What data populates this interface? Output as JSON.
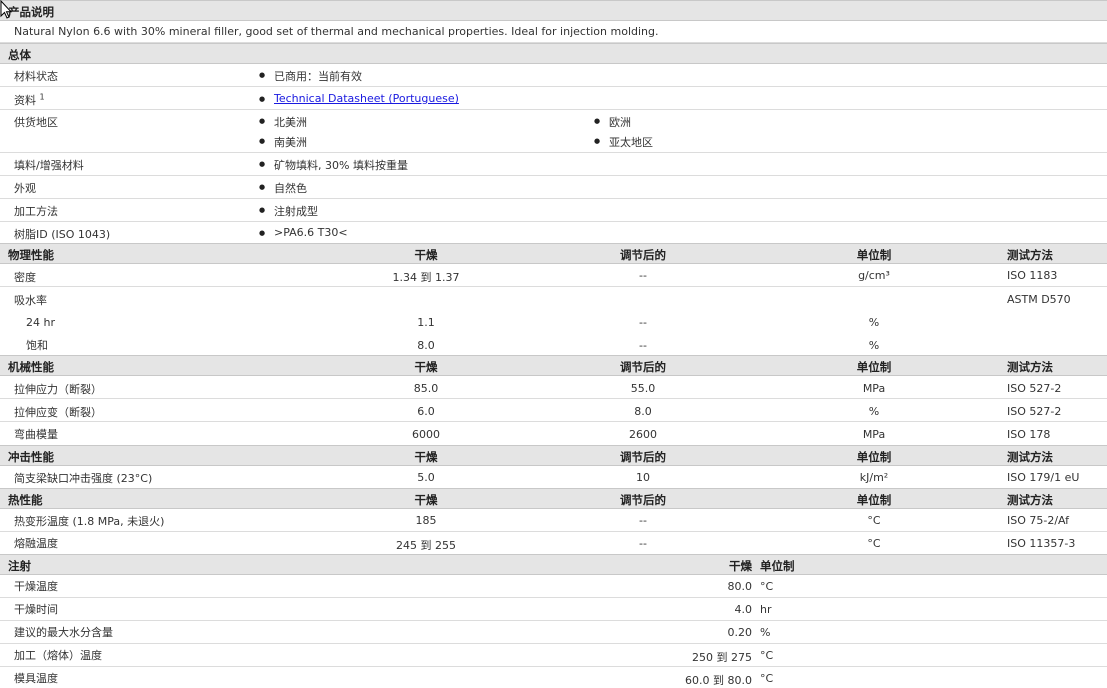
{
  "desc": {
    "title": "产品说明",
    "text": "Natural Nylon 6.6 with 30% mineral filler, good set of thermal and mechanical properties. Ideal for injection molding."
  },
  "general": {
    "title": "总体",
    "rows": [
      {
        "label": "材料状态",
        "value": "已商用：当前有效"
      },
      {
        "label": "资料",
        "sup": "1",
        "link": "Technical Datasheet (Portuguese)"
      },
      {
        "label": "供货地区",
        "regions": [
          "北美洲",
          "欧洲",
          "南美洲",
          "亚太地区"
        ]
      },
      {
        "label": "填料/增强材料",
        "value": "矿物填料, 30% 填料按重量"
      },
      {
        "label": "外观",
        "value": "自然色"
      },
      {
        "label": "加工方法",
        "value": "注射成型"
      },
      {
        "label": "树脂ID (ISO 1043)",
        "value": ">PA6.6 T30<"
      }
    ]
  },
  "headers": {
    "dry": "干燥",
    "cond": "调节后的",
    "unit": "单位制",
    "method": "测试方法"
  },
  "physical": {
    "title": "物理性能",
    "rows": [
      {
        "label": "密度",
        "dry": "1.34 到  1.37",
        "cond": "--",
        "unit": "g/cm³",
        "method": "ISO 1183"
      },
      {
        "label": "吸水率",
        "dry": "",
        "cond": "",
        "unit": "",
        "method": "ASTM D570"
      },
      {
        "label": "24 hr",
        "dry": "1.1",
        "cond": "--",
        "unit": "%",
        "method": ""
      },
      {
        "label": "饱和",
        "dry": "8.0",
        "cond": "--",
        "unit": "%",
        "method": ""
      }
    ]
  },
  "mechanical": {
    "title": "机械性能",
    "rows": [
      {
        "label": "拉伸应力（断裂）",
        "dry": "85.0",
        "cond": "55.0",
        "unit": "MPa",
        "method": "ISO 527-2"
      },
      {
        "label": "拉伸应变（断裂）",
        "dry": "6.0",
        "cond": "8.0",
        "unit": "%",
        "method": "ISO 527-2"
      },
      {
        "label": "弯曲模量",
        "dry": "6000",
        "cond": "2600",
        "unit": "MPa",
        "method": "ISO 178"
      }
    ]
  },
  "impact": {
    "title": "冲击性能",
    "rows": [
      {
        "label": "简支梁缺口冲击强度 (23°C)",
        "dry": "5.0",
        "cond": "10",
        "unit": "kJ/m²",
        "method": "ISO 179/1 eU"
      }
    ]
  },
  "thermal": {
    "title": "热性能",
    "rows": [
      {
        "label": "热变形温度 (1.8 MPa, 未退火)",
        "dry": "185",
        "cond": "--",
        "unit": "°C",
        "method": "ISO 75-2/Af"
      },
      {
        "label": "熔融温度",
        "dry": "245 到  255",
        "cond": "--",
        "unit": "°C",
        "method": "ISO 11357-3"
      }
    ]
  },
  "injection": {
    "title": "注射",
    "dry_header": "干燥",
    "unit_header": "单位制",
    "rows": [
      {
        "label": "干燥温度",
        "dry": "80.0",
        "unit": "°C"
      },
      {
        "label": "干燥时间",
        "dry": "4.0",
        "unit": "hr"
      },
      {
        "label": "建议的最大水分含量",
        "dry": "0.20",
        "unit": "%"
      },
      {
        "label": "加工（熔体）温度",
        "dry": "250 到  275",
        "unit": "°C"
      },
      {
        "label": "模具温度",
        "dry": "60.0 到  80.0",
        "unit": "°C"
      }
    ]
  }
}
